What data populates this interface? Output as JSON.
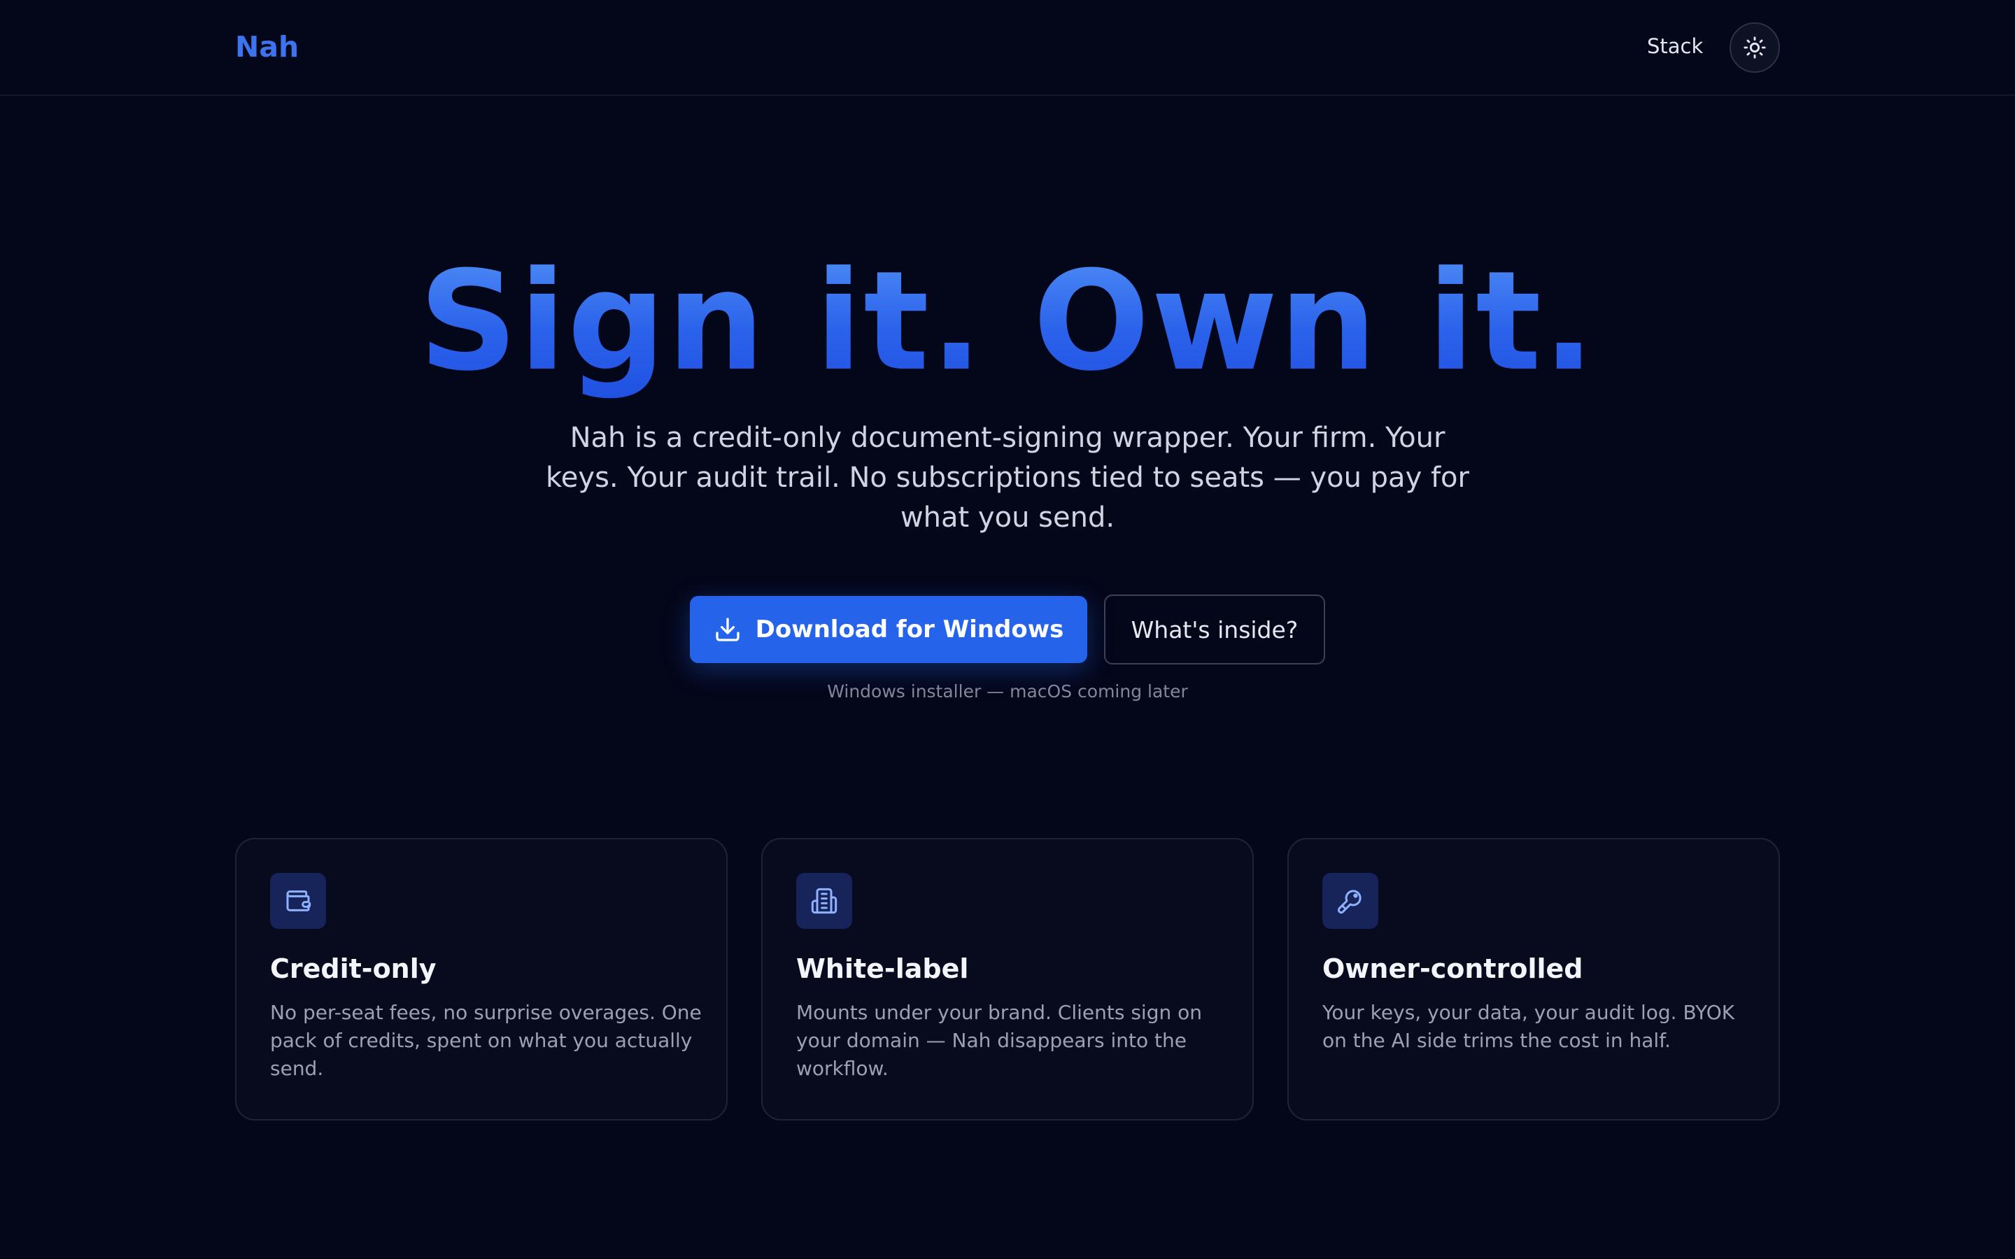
{
  "header": {
    "logo": "Nah",
    "nav_stack": "Stack",
    "theme_toggle_icon": "sun-icon"
  },
  "hero": {
    "title": "Sign it. Own it.",
    "subtitle": "Nah is a credit-only document-signing wrapper. Your firm. Your keys. Your audit trail. No subscriptions tied to seats — you pay for what you send.",
    "download_label": "Download for Windows",
    "download_icon": "download-icon",
    "secondary_label": "What's inside?",
    "installer_note": "Windows installer — macOS coming later"
  },
  "features": [
    {
      "icon": "wallet-icon",
      "title": "Credit-only",
      "body": "No per-seat fees, no surprise overages. One pack of credits, spent on what you actually send."
    },
    {
      "icon": "building-icon",
      "title": "White-label",
      "body": "Mounts under your brand. Clients sign on your domain — Nah disappears into the workflow."
    },
    {
      "icon": "key-icon",
      "title": "Owner-controlled",
      "body": "Your keys, your data, your audit log. BYOK on the AI side trims the cost in half."
    }
  ],
  "colors": {
    "background": "#04071a",
    "accent": "#2563eb",
    "logo": "#3b74ee",
    "icon_tile": "#17245a"
  }
}
